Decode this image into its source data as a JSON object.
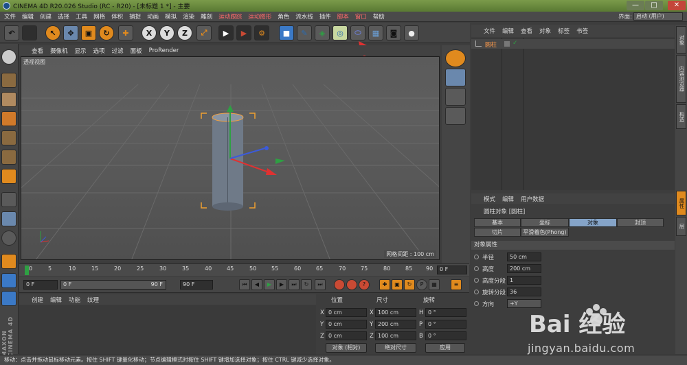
{
  "window": {
    "title": "CINEMA 4D R20.026 Studio (RC - R20) - [未标题 1 *] - 主要",
    "min": "—",
    "max": "□",
    "close": "✕"
  },
  "menubar": {
    "items": [
      "文件",
      "编辑",
      "创建",
      "选择",
      "工具",
      "网格",
      "体积",
      "捕捉",
      "动画",
      "模拟",
      "渲染",
      "雕刻",
      "运动跟踪",
      "运动图形",
      "角色",
      "流水线",
      "插件",
      "脚本",
      "窗口",
      "帮助"
    ],
    "layout_label": "界面:",
    "layout_value": "启动 (用户)"
  },
  "viewport": {
    "menu": [
      "查看",
      "摄像机",
      "显示",
      "选项",
      "过滤",
      "面板",
      "ProRender"
    ],
    "title": "透视视图",
    "grid_info": "网格间距 : 100 cm"
  },
  "timeline": {
    "ticks": [
      "0",
      "5",
      "10",
      "15",
      "20",
      "25",
      "30",
      "35",
      "40",
      "45",
      "50",
      "55",
      "60",
      "65",
      "70",
      "75",
      "80",
      "85",
      "90"
    ],
    "current_frame": "0 F",
    "start": "0 F",
    "slider_start": "0 F",
    "slider_end": "90 F",
    "end": "90 F"
  },
  "material": {
    "menu": [
      "创建",
      "编辑",
      "功能",
      "纹理"
    ]
  },
  "coordinates": {
    "headers": [
      "位置",
      "尺寸",
      "旋转"
    ],
    "rows": [
      {
        "pos_axis": "X",
        "pos": "0 cm",
        "size_axis": "X",
        "size": "100 cm",
        "rot_axis": "H",
        "rot": "0 °"
      },
      {
        "pos_axis": "Y",
        "pos": "0 cm",
        "size_axis": "Y",
        "size": "200 cm",
        "rot_axis": "P",
        "rot": "0 °"
      },
      {
        "pos_axis": "Z",
        "pos": "0 cm",
        "size_axis": "Z",
        "size": "100 cm",
        "rot_axis": "B",
        "rot": "0 °"
      }
    ],
    "mode_object": "对象 (相对)",
    "mode_size": "绝对尺寸",
    "apply": "应用"
  },
  "object_manager": {
    "menu": [
      "文件",
      "编辑",
      "查看",
      "对象",
      "标签",
      "书签"
    ],
    "objects": [
      {
        "name": "圆柱"
      }
    ]
  },
  "attributes": {
    "menu": [
      "模式",
      "编辑",
      "用户数据"
    ],
    "title": "圆柱对象 [圆柱]",
    "tabs_row1": [
      "基本",
      "坐标",
      "对象",
      "封顶"
    ],
    "tabs_row2": [
      "切片",
      "平滑着色(Phong)"
    ],
    "active_tab": "对象",
    "section": "对象属性",
    "params": [
      {
        "label": "半径",
        "value": "50 cm"
      },
      {
        "label": "高度",
        "value": "200 cm"
      },
      {
        "label": "高度分段",
        "value": "1"
      },
      {
        "label": "旋转分段",
        "value": "36"
      },
      {
        "label": "方向",
        "value": "+Y"
      }
    ]
  },
  "right_tabs": [
    "对象",
    "内容浏览器",
    "构造",
    "属性",
    "层"
  ],
  "statusbar": "移动：点击并拖动鼠标移动元素。按住 SHIFT 键量化移动；节点编辑模式时按住 SHIFT 键增加选择对象；按住 CTRL 键减少选择对象。",
  "branding": {
    "maxon": "MAXON CINEMA 4D"
  },
  "watermark": {
    "logo": "Bai 经验",
    "url": "jingyan.baidu.com"
  }
}
